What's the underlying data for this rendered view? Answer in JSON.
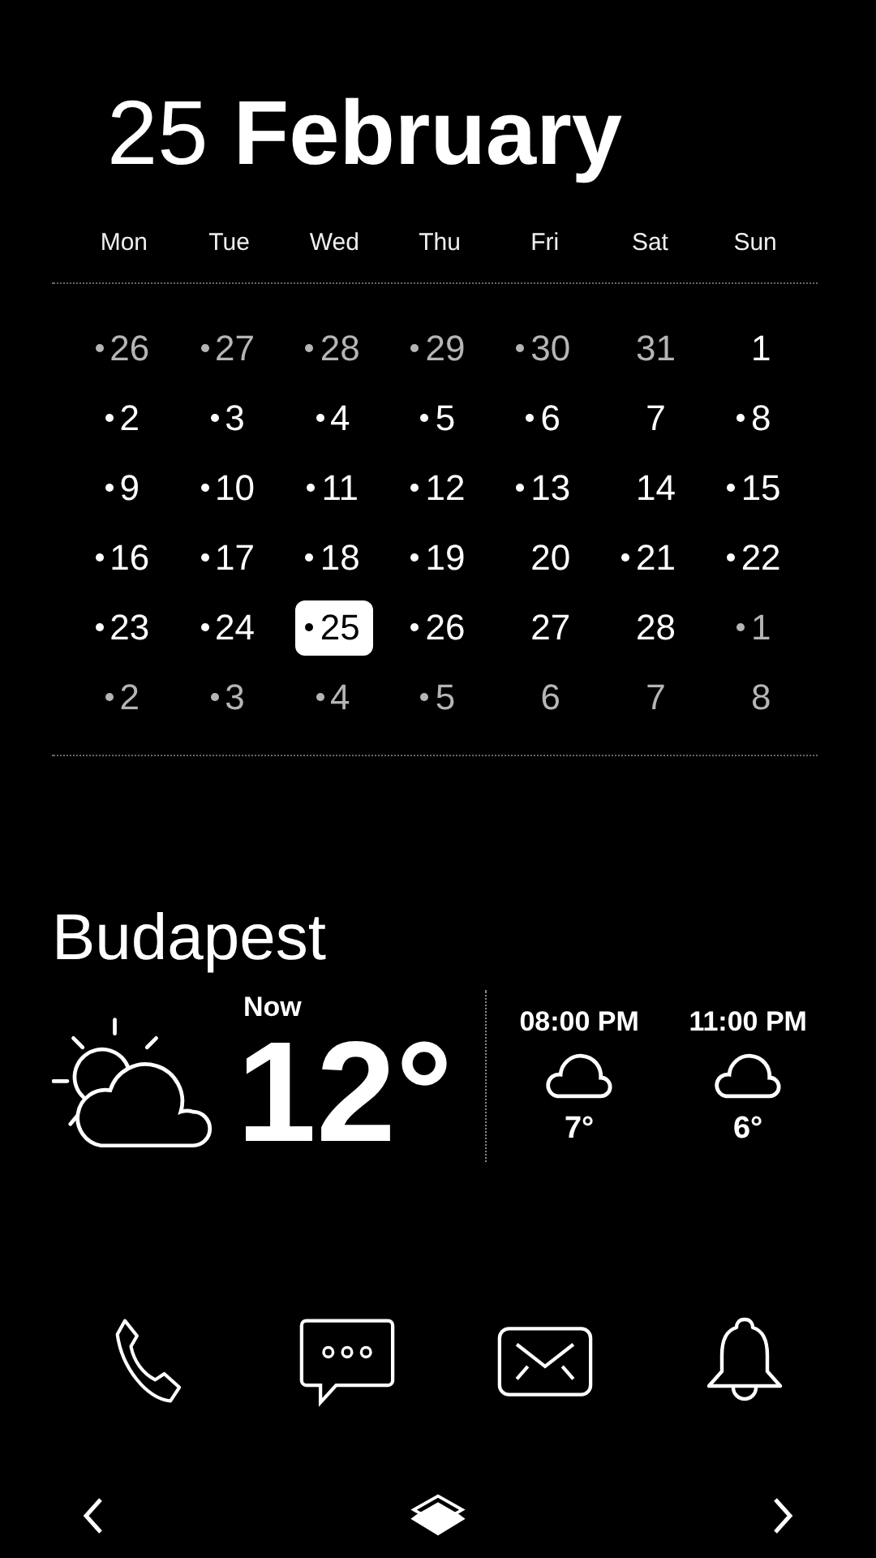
{
  "date_title": "25 **February**",
  "weekdays": [
    "Mon",
    "Tue",
    "Wed",
    "Thu",
    "Fri",
    "Sat",
    "Sun"
  ],
  "weeks": [
    [
      {
        "day": "26",
        "event": true,
        "other_month": true,
        "selected": false
      },
      {
        "day": "27",
        "event": true,
        "other_month": true,
        "selected": false
      },
      {
        "day": "28",
        "event": true,
        "other_month": true,
        "selected": false
      },
      {
        "day": "29",
        "event": true,
        "other_month": true,
        "selected": false
      },
      {
        "day": "30",
        "event": true,
        "other_month": true,
        "selected": false
      },
      {
        "day": "31",
        "event": false,
        "other_month": true,
        "selected": false
      },
      {
        "day": "1",
        "event": false,
        "other_month": false,
        "selected": false
      }
    ],
    [
      {
        "day": "2",
        "event": true,
        "other_month": false,
        "selected": false
      },
      {
        "day": "3",
        "event": true,
        "other_month": false,
        "selected": false
      },
      {
        "day": "4",
        "event": true,
        "other_month": false,
        "selected": false
      },
      {
        "day": "5",
        "event": true,
        "other_month": false,
        "selected": false
      },
      {
        "day": "6",
        "event": true,
        "other_month": false,
        "selected": false
      },
      {
        "day": "7",
        "event": false,
        "other_month": false,
        "selected": false
      },
      {
        "day": "8",
        "event": true,
        "other_month": false,
        "selected": false
      }
    ],
    [
      {
        "day": "9",
        "event": true,
        "other_month": false,
        "selected": false
      },
      {
        "day": "10",
        "event": true,
        "other_month": false,
        "selected": false
      },
      {
        "day": "11",
        "event": true,
        "other_month": false,
        "selected": false
      },
      {
        "day": "12",
        "event": true,
        "other_month": false,
        "selected": false
      },
      {
        "day": "13",
        "event": true,
        "other_month": false,
        "selected": false
      },
      {
        "day": "14",
        "event": false,
        "other_month": false,
        "selected": false
      },
      {
        "day": "15",
        "event": true,
        "other_month": false,
        "selected": false
      }
    ],
    [
      {
        "day": "16",
        "event": true,
        "other_month": false,
        "selected": false
      },
      {
        "day": "17",
        "event": true,
        "other_month": false,
        "selected": false
      },
      {
        "day": "18",
        "event": true,
        "other_month": false,
        "selected": false
      },
      {
        "day": "19",
        "event": true,
        "other_month": false,
        "selected": false
      },
      {
        "day": "20",
        "event": false,
        "other_month": false,
        "selected": false
      },
      {
        "day": "21",
        "event": true,
        "other_month": false,
        "selected": false
      },
      {
        "day": "22",
        "event": true,
        "other_month": false,
        "selected": false
      }
    ],
    [
      {
        "day": "23",
        "event": true,
        "other_month": false,
        "selected": false
      },
      {
        "day": "24",
        "event": true,
        "other_month": false,
        "selected": false
      },
      {
        "day": "25",
        "event": true,
        "other_month": false,
        "selected": true
      },
      {
        "day": "26",
        "event": true,
        "other_month": false,
        "selected": false
      },
      {
        "day": "27",
        "event": false,
        "other_month": false,
        "selected": false
      },
      {
        "day": "28",
        "event": false,
        "other_month": false,
        "selected": false
      },
      {
        "day": "1",
        "event": true,
        "other_month": true,
        "selected": false
      }
    ],
    [
      {
        "day": "2",
        "event": true,
        "other_month": true,
        "selected": false
      },
      {
        "day": "3",
        "event": true,
        "other_month": true,
        "selected": false
      },
      {
        "day": "4",
        "event": true,
        "other_month": true,
        "selected": false
      },
      {
        "day": "5",
        "event": true,
        "other_month": true,
        "selected": false
      },
      {
        "day": "6",
        "event": false,
        "other_month": true,
        "selected": false
      },
      {
        "day": "7",
        "event": false,
        "other_month": true,
        "selected": false
      },
      {
        "day": "8",
        "event": false,
        "other_month": true,
        "selected": false
      }
    ]
  ],
  "weather": {
    "city": "Budapest",
    "current": {
      "label": "Now",
      "temp": "12°",
      "kind": "partly_cloudy"
    },
    "forecast": [
      {
        "time": "08:00 PM",
        "temp": "7°",
        "kind": "cloudy"
      },
      {
        "time": "11:00 PM",
        "temp": "6°",
        "kind": "cloudy"
      }
    ]
  },
  "dock": [
    {
      "kind": "phone"
    },
    {
      "kind": "message"
    },
    {
      "kind": "mail"
    },
    {
      "kind": "bell"
    }
  ],
  "nav": [
    {
      "kind": "back"
    },
    {
      "kind": "home"
    },
    {
      "kind": "forward"
    }
  ]
}
